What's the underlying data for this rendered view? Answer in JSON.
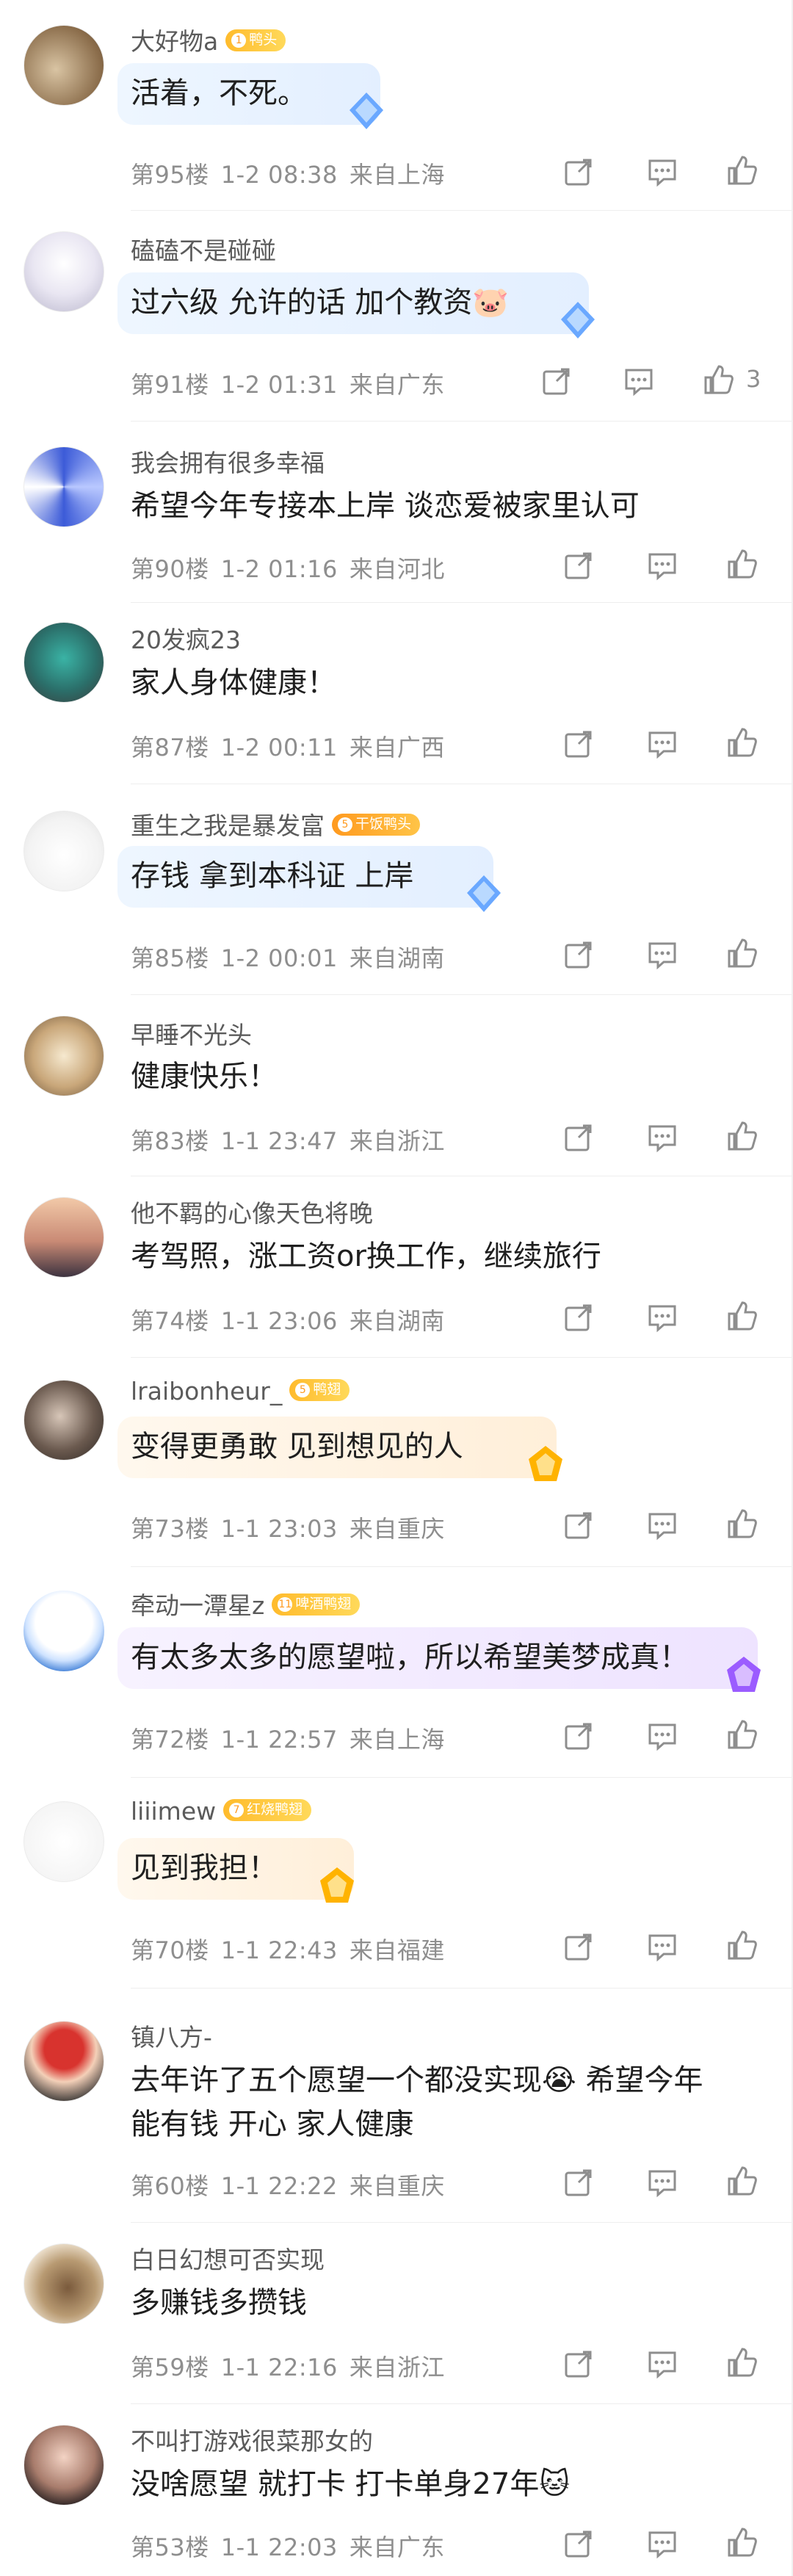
{
  "comments": [
    {
      "username": "大好物a",
      "badge": "鸭头",
      "badge_level": "",
      "text": "活着，不死。",
      "floor": "第95楼",
      "time": "1-2 08:38",
      "location": "来自上海",
      "likes": "",
      "gem": true
    },
    {
      "username": "磕磕不是碰碰",
      "badge": "",
      "badge_level": "",
      "text": "过六级 允许的话 加个教资🐷",
      "floor": "第91楼",
      "time": "1-2 01:31",
      "location": "来自广东",
      "likes": "3",
      "gem": true
    },
    {
      "username": "我会拥有很多幸福",
      "badge": "",
      "badge_level": "",
      "text": "希望今年专接本上岸  谈恋爱被家里认可",
      "floor": "第90楼",
      "time": "1-2 01:16",
      "location": "来自河北",
      "likes": "",
      "gem": false
    },
    {
      "username": "20发疯23",
      "badge": "",
      "badge_level": "",
      "text": "家人身体健康！",
      "floor": "第87楼",
      "time": "1-2 00:11",
      "location": "来自广西",
      "likes": "",
      "gem": false
    },
    {
      "username": "重生之我是暴发富",
      "badge": "干饭鸭头",
      "badge_level": "5",
      "text": "存钱 拿到本科证 上岸",
      "floor": "第85楼",
      "time": "1-2 00:01",
      "location": "来自湖南",
      "likes": "",
      "gem": true
    },
    {
      "username": "早睡不光头",
      "badge": "",
      "badge_level": "",
      "text": "健康快乐！",
      "floor": "第83楼",
      "time": "1-1 23:47",
      "location": "来自浙江",
      "likes": "",
      "gem": false
    },
    {
      "username": "他不羁的心像天色将晚",
      "badge": "",
      "badge_level": "",
      "text": "考驾照，涨工资or换工作，继续旅行",
      "floor": "第74楼",
      "time": "1-1 23:06",
      "location": "来自湖南",
      "likes": "",
      "gem": false
    },
    {
      "username": "lraibonheur_",
      "badge": "鸭翅",
      "badge_level": "5",
      "text": "变得更勇敢 见到想见的人",
      "floor": "第73楼",
      "time": "1-1 23:03",
      "location": "来自重庆",
      "likes": "",
      "gem": true
    },
    {
      "username": "牵动一潭星z",
      "badge": "啤酒鸭翅",
      "badge_level": "11",
      "text": "有太多太多的愿望啦，所以希望美梦成真！",
      "floor": "第72楼",
      "time": "1-1 22:57",
      "location": "来自上海",
      "likes": "",
      "gem": true
    },
    {
      "username": "liiimew",
      "badge": "红烧鸭翅",
      "badge_level": "7",
      "text": "见到我担！",
      "floor": "第70楼",
      "time": "1-1 22:43",
      "location": "来自福建",
      "likes": "",
      "gem": true
    },
    {
      "username": "镇八方-",
      "badge": "",
      "badge_level": "",
      "text": "去年许了五个愿望一个都没实现😭 希望今年",
      "text2": "能有钱 开心 家人健康",
      "floor": "第60楼",
      "time": "1-1 22:22",
      "location": "来自重庆",
      "likes": "",
      "gem": false
    },
    {
      "username": "白日幻想可否实现",
      "badge": "",
      "badge_level": "",
      "text": "多赚钱多攒钱",
      "floor": "第59楼",
      "time": "1-1 22:16",
      "location": "来自浙江",
      "likes": "",
      "gem": false
    },
    {
      "username": "不叫打游戏很菜那女的",
      "badge": "",
      "badge_level": "",
      "text": "没啥愿望 就打卡 打卡单身27年🐱",
      "floor": "第53楼",
      "time": "1-1 22:03",
      "location": "来自广东",
      "likes": "",
      "gem": false
    }
  ],
  "icons": {
    "share": "share-icon",
    "reply": "reply-icon",
    "like": "thumbs-up-icon",
    "gem": "diamond-gem-icon"
  },
  "colors": {
    "meta": "#8e8e8e",
    "badge": "#ffbb2c",
    "bubble_blue": "#eaf3ff",
    "bubble_pink": "#ffeef3",
    "bubble_gold": "#fff4e3",
    "bubble_purple": "#f4ecff"
  }
}
